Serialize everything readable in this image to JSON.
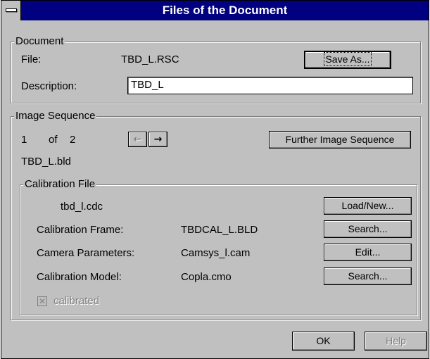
{
  "window": {
    "title": "Files of the Document"
  },
  "document_group": {
    "legend": "Document",
    "file_label": "File:",
    "file_value": "TBD_L.RSC",
    "save_as_button": "Save As...",
    "description_label": "Description:",
    "description_value": "TBD_L"
  },
  "image_sequence_group": {
    "legend": "Image Sequence",
    "index": "1",
    "of_label": "of",
    "total": "2",
    "prev_icon": "arrow-left-icon",
    "next_icon": "arrow-right-icon",
    "further_button": "Further Image Sequence",
    "filename": "TBD_L.bld"
  },
  "calibration_group": {
    "legend": "Calibration File",
    "file_value": "tbd_l.cdc",
    "load_new_button": "Load/New...",
    "frame_label": "Calibration Frame:",
    "frame_value": "TBDCAL_L.BLD",
    "frame_search_button": "Search...",
    "camera_label": "Camera Parameters:",
    "camera_value": "Camsys_l.cam",
    "camera_edit_button": "Edit...",
    "model_label": "Calibration Model:",
    "model_value": "Copla.cmo",
    "model_search_button": "Search...",
    "calibrated_label": "calibrated",
    "calibrated_checked": true
  },
  "footer": {
    "ok_button": "OK",
    "help_button": "Help"
  }
}
